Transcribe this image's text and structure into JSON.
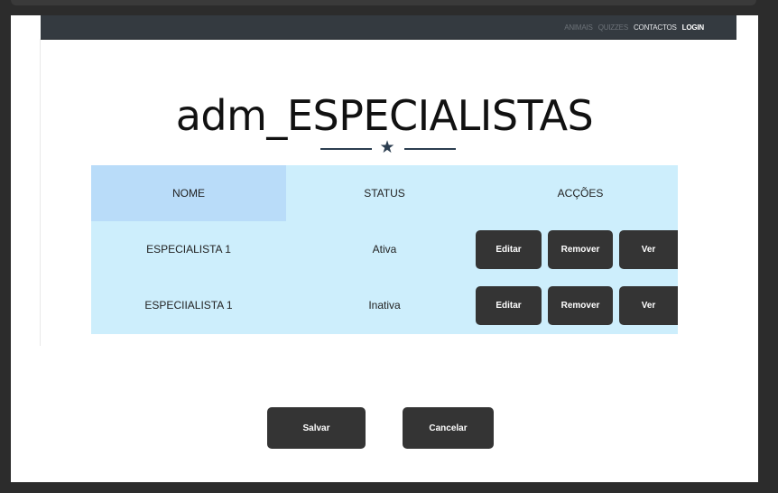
{
  "nav": {
    "links": [
      "ANIMAIS",
      "QUIZZES",
      "CONTACTOS",
      "LOGIN"
    ]
  },
  "page": {
    "title": "adm_ESPECIALISTAS",
    "divider_icon": "star-icon"
  },
  "table": {
    "headers": [
      "NOME",
      "STATUS",
      "ACÇÕES"
    ],
    "rows": [
      {
        "nome": "ESPECIALISTA  1",
        "status": "Ativa"
      },
      {
        "nome": "ESPECIIALISTA 1",
        "status": "Inativa"
      }
    ],
    "actions": [
      "Editar",
      "Remover",
      "Ver"
    ]
  },
  "footer": {
    "save_label": "Salvar",
    "cancel_label": "Cancelar"
  },
  "colors": {
    "navbar": "#343a40",
    "table_bg": "#cdeefc",
    "header_highlight": "#b9dcf9",
    "button": "#343434",
    "accent": "#2c3e50"
  }
}
